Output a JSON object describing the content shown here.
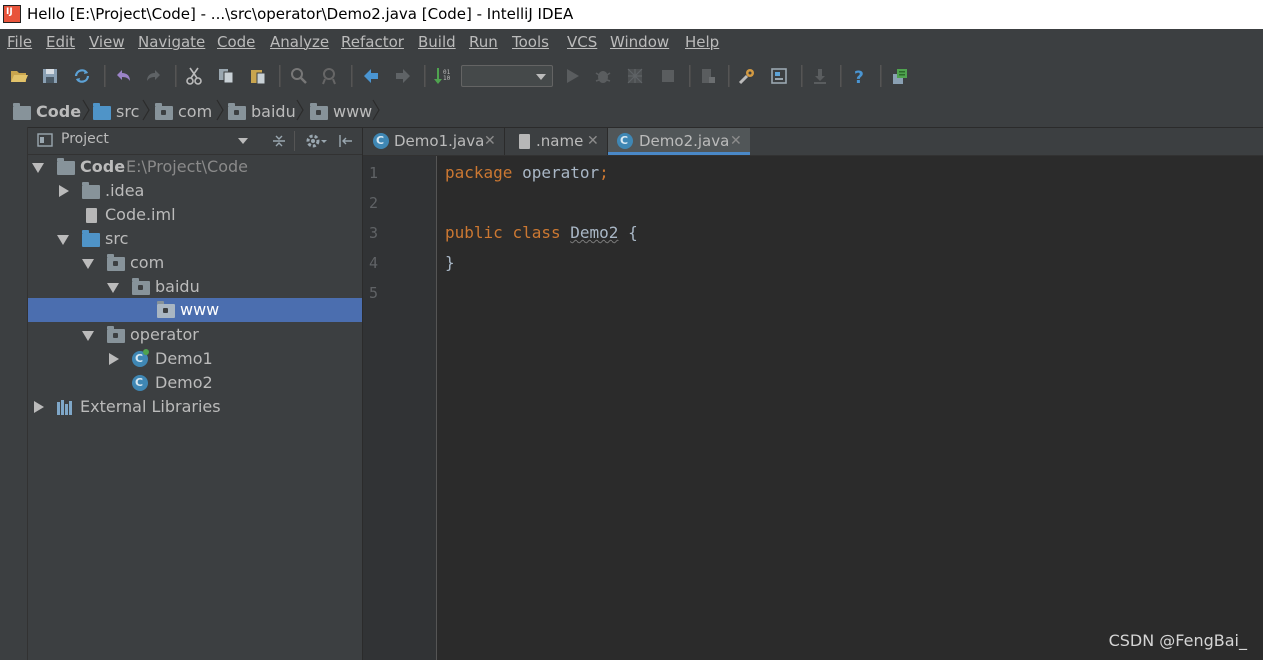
{
  "window": {
    "title": "Hello [E:\\Project\\Code] - ...\\src\\operator\\Demo2.java [Code] - IntelliJ IDEA"
  },
  "menu": {
    "items": [
      "File",
      "Edit",
      "View",
      "Navigate",
      "Code",
      "Analyze",
      "Refactor",
      "Build",
      "Run",
      "Tools",
      "VCS",
      "Window",
      "Help"
    ]
  },
  "toolbar": {
    "icons": [
      "open-folder-icon",
      "save-icon",
      "sync-icon",
      "undo-icon",
      "redo-icon",
      "cut-icon",
      "copy-icon",
      "paste-icon",
      "find-icon",
      "replace-icon",
      "back-icon",
      "forward-icon",
      "build-icon",
      "run-config-select",
      "run-icon",
      "debug-icon",
      "coverage-icon",
      "stop-icon",
      "project-structure-icon",
      "settings-icon",
      "sdk-icon",
      "update-icon",
      "help-icon",
      "event-log-icon"
    ],
    "run_config_value": ""
  },
  "breadcrumb": {
    "items": [
      "Code",
      "src",
      "com",
      "baidu",
      "www"
    ]
  },
  "project": {
    "header_label": "Project",
    "tree": [
      {
        "label": "Code",
        "path": "E:\\Project\\Code"
      },
      {
        "label": ".idea"
      },
      {
        "label": "Code.iml"
      },
      {
        "label": "src"
      },
      {
        "label": "com"
      },
      {
        "label": "baidu"
      },
      {
        "label": "www"
      },
      {
        "label": "operator"
      },
      {
        "label": "Demo1"
      },
      {
        "label": "Demo2"
      },
      {
        "label": "External Libraries"
      }
    ]
  },
  "editor": {
    "tabs": [
      {
        "label": "Demo1.java"
      },
      {
        "label": ".name"
      },
      {
        "label": "Demo2.java"
      }
    ],
    "line_numbers": [
      "1",
      "2",
      "3",
      "4",
      "5"
    ],
    "code": {
      "l1_kw": "package",
      "l1_rest": " operator",
      "l1_semi": ";",
      "l3_kw1": "public",
      "l3_kw2": "class",
      "l3_name": "Demo2",
      "l3_brace": "{",
      "l4": "}"
    }
  },
  "watermark": "CSDN @FengBai_",
  "colors": {
    "background": "#2b2b2b",
    "panel": "#3c3f41",
    "selection": "#4b6eaf",
    "keyword": "#cc7832",
    "text": "#a9b7c6"
  }
}
